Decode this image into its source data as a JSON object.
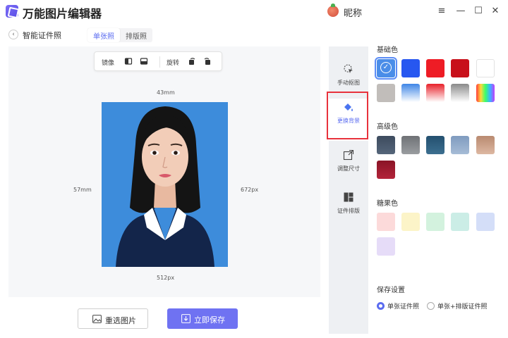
{
  "app": {
    "title": "万能图片编辑器",
    "nickname": "昵称"
  },
  "window_controls": {
    "menu": "≡",
    "minimize": "—",
    "maximize": "☐",
    "close": "✕"
  },
  "header": {
    "back": "‹",
    "page_title": "智能证件照",
    "tabs": [
      "单张照",
      "排版照"
    ],
    "active_tab": 0
  },
  "toolbar": {
    "mirror_label": "镜像",
    "rotate_label": "旋转"
  },
  "photo": {
    "width_mm": "43mm",
    "height_mm": "57mm",
    "width_px": "512px",
    "height_px": "672px",
    "background_color": "#3d8cdb"
  },
  "buttons": {
    "reselect": "重选图片",
    "save": "立即保存"
  },
  "func_sidebar": {
    "items": [
      {
        "label": "手动抠图",
        "icon": "cursor-click-icon"
      },
      {
        "label": "更换背景",
        "icon": "paint-bucket-icon"
      },
      {
        "label": "调整尺寸",
        "icon": "resize-icon"
      },
      {
        "label": "证件排版",
        "icon": "grid-layout-icon"
      }
    ],
    "active_index": 1
  },
  "colors": {
    "basic_title": "基础色",
    "advanced_title": "高级色",
    "candy_title": "糖果色",
    "basic": [
      "#4a8de8",
      "#2757f0",
      "#ee1c25",
      "#c8101a",
      "#ffffff",
      "#c1bdba",
      "gradient-blue",
      "gradient-red",
      "gradient-gray",
      "gradient-rainbow"
    ],
    "advanced": [
      "#3d4b5e",
      "#7a7d80",
      "#2f5c80",
      "#8ea8c8",
      "#c49a80",
      "#9e1a2d"
    ],
    "candy": [
      "#fcdada",
      "#fcf4c8",
      "#d3f2de",
      "#cbede6",
      "#d4def8",
      "#e6dcf8"
    ],
    "selected_basic_index": 0
  },
  "save_settings": {
    "title": "保存设置",
    "options": [
      "单张证件照",
      "单张+排版证件照"
    ],
    "selected_index": 0
  }
}
